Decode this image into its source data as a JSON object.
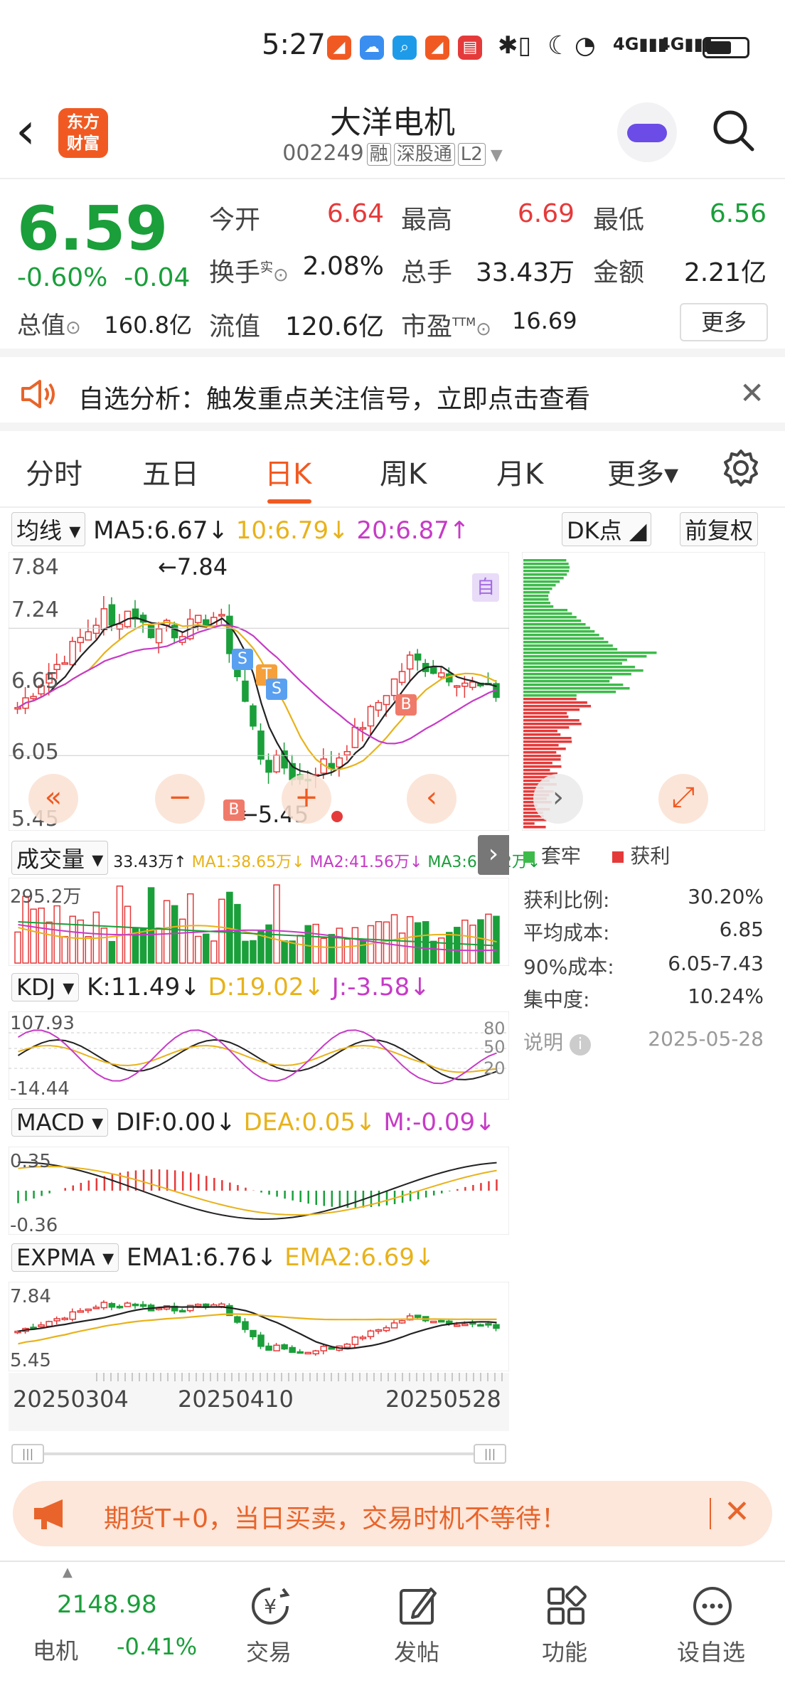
{
  "status_bar": {
    "time": "5:27"
  },
  "header": {
    "title": "大洋电机",
    "code": "002249",
    "tags": [
      "融",
      "深股通",
      "L2"
    ],
    "logo_text": [
      "东方",
      "财富"
    ]
  },
  "quote": {
    "price": "6.59",
    "change_pct": "-0.60%",
    "change": "-0.04",
    "open_label": "今开",
    "open": "6.64",
    "high_label": "最高",
    "high": "6.69",
    "low_label": "最低",
    "low": "6.56",
    "turnover_label": "换手",
    "turnover_sup": "实",
    "turnover": "2.08%",
    "volume_label": "总手",
    "volume": "33.43万",
    "amount_label": "金额",
    "amount": "2.21亿",
    "mktcap_label": "总值",
    "mktcap": "160.8亿",
    "float_label": "流值",
    "float": "120.6亿",
    "pe_label": "市盈",
    "pe_sup": "TTM",
    "pe": "16.69",
    "more_label": "更多"
  },
  "notice": {
    "text": "自选分析：触发重点关注信号，立即点击查看"
  },
  "tabs": [
    "分时",
    "五日",
    "日K",
    "周K",
    "月K",
    "更多▾"
  ],
  "active_tab": "日K",
  "kline": {
    "ma_selector": "均线",
    "ma5": "MA5:6.67↓",
    "ma10": "10:6.79↓",
    "ma20": "20:6.87↑",
    "dk_button": "DK点",
    "adjust_button": "前复权",
    "y_labels": [
      "7.84",
      "7.24",
      "6.65",
      "6.05",
      "5.45"
    ],
    "high_marker": "←7.84",
    "low_marker": "←5.45",
    "self_marker": "自",
    "signal_s": "S",
    "signal_b": "B",
    "signal_t": "T"
  },
  "volume": {
    "selector": "成交量",
    "vol": "33.43万↑",
    "ma1": "MA1:38.65万↓",
    "ma2": "MA2:41.56万↓",
    "ma3": "MA3:65.62万↓",
    "max_label": "295.2万"
  },
  "kdj": {
    "selector": "KDJ",
    "k": "K:11.49↓",
    "d": "D:19.02↓",
    "j": "J:-3.58↓",
    "top": "107.93",
    "bottom": "-14.44",
    "levels": [
      "80",
      "50",
      "20"
    ]
  },
  "macd": {
    "selector": "MACD",
    "dif": "DIF:0.00↓",
    "dea": "DEA:0.05↓",
    "m": "M:-0.09↓",
    "top": "0.35",
    "bottom": "-0.36"
  },
  "expma": {
    "selector": "EXPMA",
    "ema1": "EMA1:6.76↓",
    "ema2": "EMA2:6.69↓",
    "top": "7.84",
    "bottom": "5.45"
  },
  "dates": [
    "20250304",
    "20250410",
    "20250528"
  ],
  "chips": {
    "legend_trapped": "套牢",
    "legend_profit": "获利",
    "profit_ratio_label": "获利比例:",
    "profit_ratio": "30.20%",
    "avg_cost_label": "平均成本:",
    "avg_cost": "6.85",
    "cost90_label": "90%成本:",
    "cost90": "6.05-7.43",
    "concentration_label": "集中度:",
    "concentration": "10.24%",
    "note_label": "说明",
    "date": "2025-05-28"
  },
  "promo": {
    "text": "期货T+0，当日买卖，交易时机不等待！"
  },
  "bottom_bar": {
    "index_value": "2148.98",
    "index_name": "电机",
    "index_change": "-0.41%",
    "items": [
      "交易",
      "发帖",
      "功能",
      "设自选"
    ]
  },
  "colors": {
    "up": "#e53a3a",
    "down": "#1a9f3a",
    "accent": "#f05a22",
    "ma5": "#222222",
    "ma10": "#e8b21a",
    "ma20": "#c63bc6"
  }
}
